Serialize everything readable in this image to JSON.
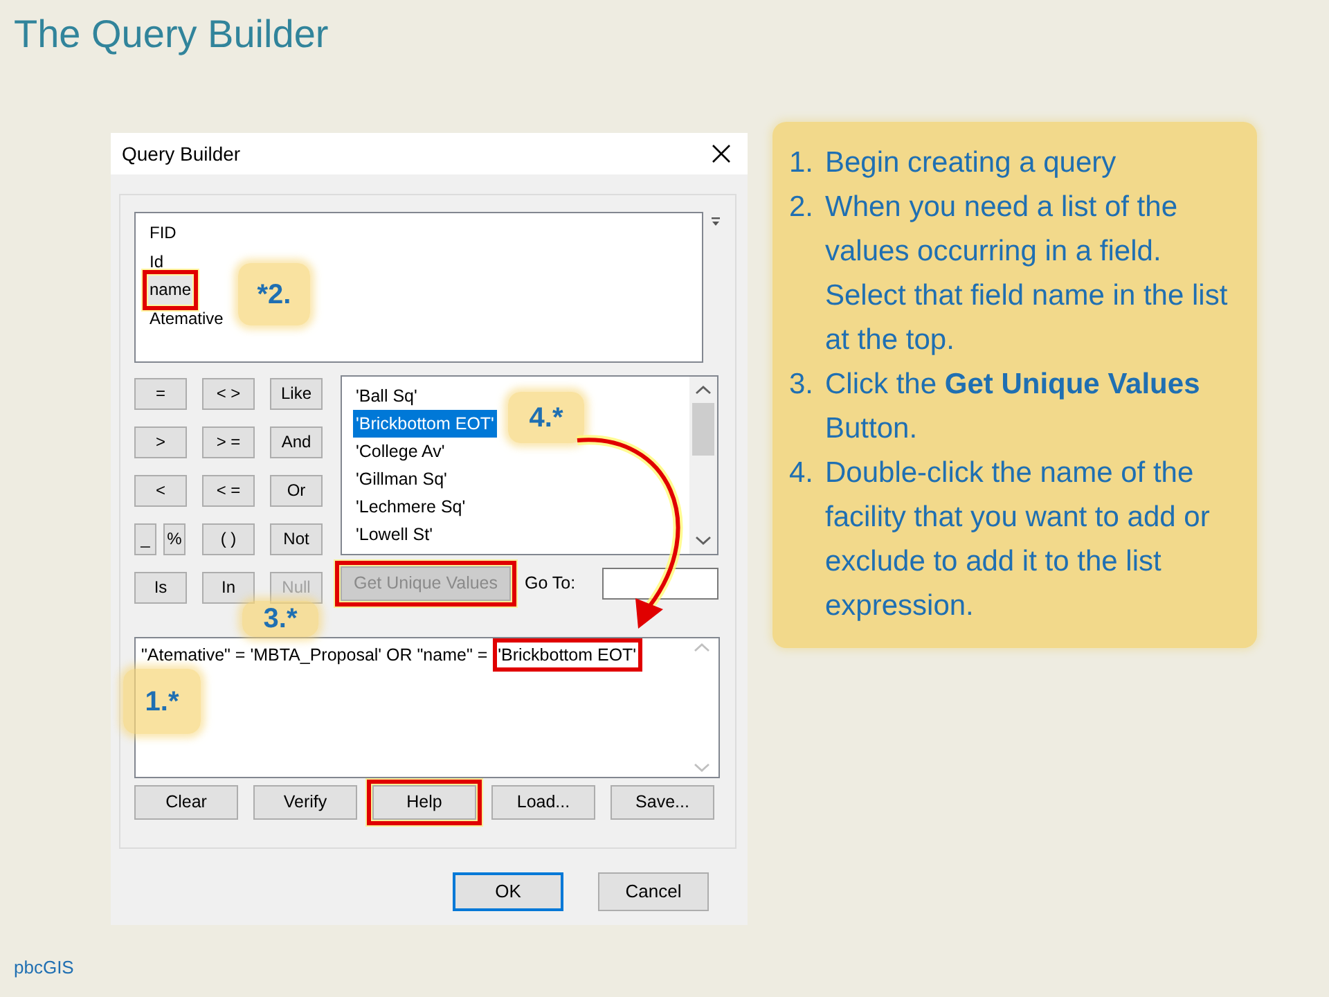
{
  "slide_title": "The Query Builder",
  "dialog": {
    "title": "Query Builder",
    "fields": [
      {
        "label": "FID",
        "selected": false,
        "highlighted": false
      },
      {
        "label": "Id",
        "selected": false,
        "highlighted": false
      },
      {
        "label": "name",
        "selected": true,
        "highlighted": true
      },
      {
        "label": "Atemative",
        "selected": false,
        "highlighted": false
      }
    ],
    "operators": [
      [
        {
          "label": "=",
          "kind": "wide",
          "disabled": false
        },
        {
          "label": "< >",
          "kind": "wide",
          "disabled": false
        },
        {
          "label": "Like",
          "kind": "wide",
          "disabled": false
        }
      ],
      [
        {
          "label": ">",
          "kind": "wide",
          "disabled": false
        },
        {
          "label": "> =",
          "kind": "wide",
          "disabled": false
        },
        {
          "label": "And",
          "kind": "wide",
          "disabled": false
        }
      ],
      [
        {
          "label": "<",
          "kind": "wide",
          "disabled": false
        },
        {
          "label": "< =",
          "kind": "wide",
          "disabled": false
        },
        {
          "label": "Or",
          "kind": "wide",
          "disabled": false
        }
      ],
      [
        {
          "label": "_",
          "kind": "narrow",
          "disabled": false
        },
        {
          "label": "%",
          "kind": "narrow",
          "disabled": false
        },
        {
          "label": "( )",
          "kind": "wide",
          "disabled": false
        },
        {
          "label": "Not",
          "kind": "wide",
          "disabled": false
        }
      ],
      [
        {
          "label": "Is",
          "kind": "wide",
          "disabled": false
        },
        {
          "label": "In",
          "kind": "wide",
          "disabled": false
        },
        {
          "label": "Null",
          "kind": "wide",
          "disabled": true
        }
      ]
    ],
    "values": [
      {
        "label": "'Ball Sq'",
        "selected": false
      },
      {
        "label": "'Brickbottom EOT'",
        "selected": true
      },
      {
        "label": "'College Av'",
        "selected": false
      },
      {
        "label": "'Gillman Sq'",
        "selected": false
      },
      {
        "label": "'Lechmere Sq'",
        "selected": false
      },
      {
        "label": "'Lowell St'",
        "selected": false
      }
    ],
    "get_unique_values": {
      "label": "Get Unique Values",
      "disabled": true,
      "highlighted": true
    },
    "goto_label": "Go To:",
    "expression": [
      {
        "text": "\"Atemative\" = 'MBTA_Proposal' OR \"name\" = ",
        "highlighted": false
      },
      {
        "text": "'Brickbottom EOT'",
        "highlighted": true
      }
    ],
    "buttons": [
      {
        "label": "Clear",
        "highlighted": false
      },
      {
        "label": "Verify",
        "highlighted": false
      },
      {
        "label": "Help",
        "highlighted": true
      },
      {
        "label": "Load...",
        "highlighted": false
      },
      {
        "label": "Save...",
        "highlighted": false
      }
    ],
    "footer_buttons": [
      {
        "label": "OK",
        "default": true
      },
      {
        "label": "Cancel",
        "default": false
      }
    ]
  },
  "callouts": [
    {
      "label": "*2."
    },
    {
      "label": "4.*"
    },
    {
      "label": "3.*"
    },
    {
      "label": "1.*"
    }
  ],
  "instructions": [
    {
      "number": "1.",
      "text": "Begin creating a query"
    },
    {
      "number": "2.",
      "text": "When you need a list of the values occurring in a field. Select that field name in the list at the top."
    },
    {
      "number": "3.",
      "text": "Click the **Get Unique Values** Button."
    },
    {
      "number": "4.",
      "text": "Double-click  the name of the facility that you want to add or exclude to add it to the list expression."
    }
  ],
  "footer": "pbcGIS"
}
